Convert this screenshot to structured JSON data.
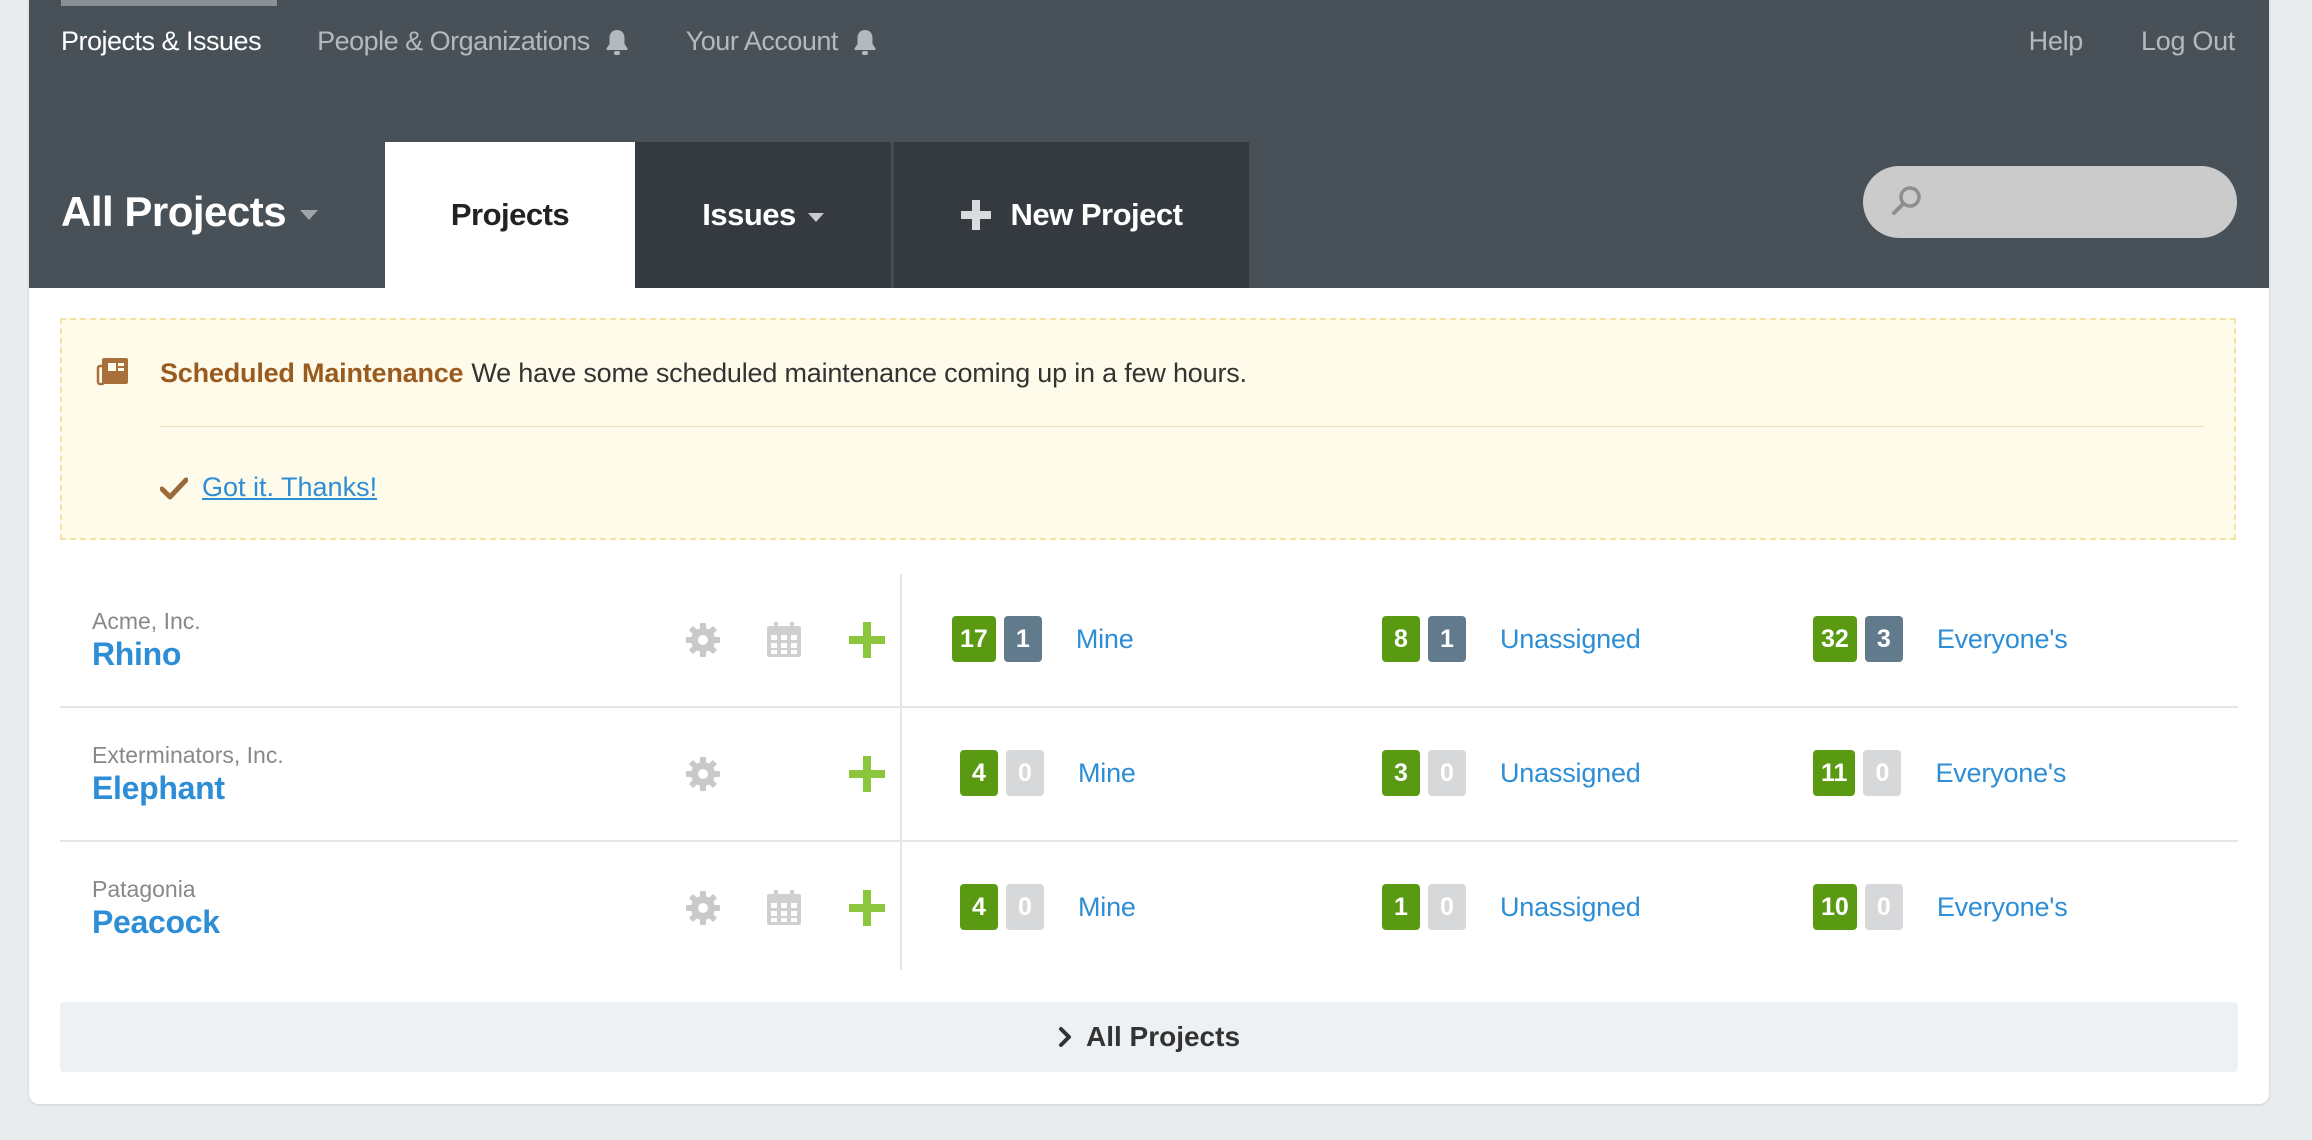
{
  "topnav": {
    "left": [
      {
        "label": "Projects & Issues",
        "active": true,
        "icon": null
      },
      {
        "label": "People & Organizations",
        "active": false,
        "icon": "bell-icon"
      },
      {
        "label": "Your Account",
        "active": false,
        "icon": "bell-icon"
      }
    ],
    "help": "Help",
    "logout": "Log Out"
  },
  "header": {
    "title": "All Projects",
    "tabs": {
      "projects": "Projects",
      "issues": "Issues",
      "new_project": "New Project"
    },
    "search": {
      "placeholder": ""
    }
  },
  "notice": {
    "icon": "newspaper-icon",
    "title": "Scheduled Maintenance",
    "message": "We have some scheduled maintenance coming up in a few hours.",
    "ack": "Got it. Thanks!"
  },
  "projects": [
    {
      "org": "Acme, Inc.",
      "name": "Rhino",
      "has_calendar": true,
      "mine": {
        "count": "17",
        "extra": "1",
        "label": "Mine"
      },
      "unassigned": {
        "count": "8",
        "extra": "1",
        "label": "Unassigned"
      },
      "everyone": {
        "count": "32",
        "extra": "3",
        "label": "Everyone's"
      }
    },
    {
      "org": "Exterminators, Inc.",
      "name": "Elephant",
      "has_calendar": false,
      "mine": {
        "count": "4",
        "extra": "0",
        "label": "Mine"
      },
      "unassigned": {
        "count": "3",
        "extra": "0",
        "label": "Unassigned"
      },
      "everyone": {
        "count": "11",
        "extra": "0",
        "label": "Everyone's"
      }
    },
    {
      "org": "Patagonia",
      "name": "Peacock",
      "has_calendar": true,
      "mine": {
        "count": "4",
        "extra": "0",
        "label": "Mine"
      },
      "unassigned": {
        "count": "1",
        "extra": "0",
        "label": "Unassigned"
      },
      "everyone": {
        "count": "10",
        "extra": "0",
        "label": "Everyone's"
      }
    }
  ],
  "footer": {
    "all_projects": "All Projects"
  },
  "colors": {
    "header_bg": "#495158",
    "tab_dark": "#343a3f",
    "link": "#2d8ed6",
    "badge_green": "#5a9a12",
    "badge_slate": "#617a8c",
    "badge_zero": "#d6d8da",
    "notice_bg": "#fffbea",
    "add_green": "#8cc63f"
  }
}
